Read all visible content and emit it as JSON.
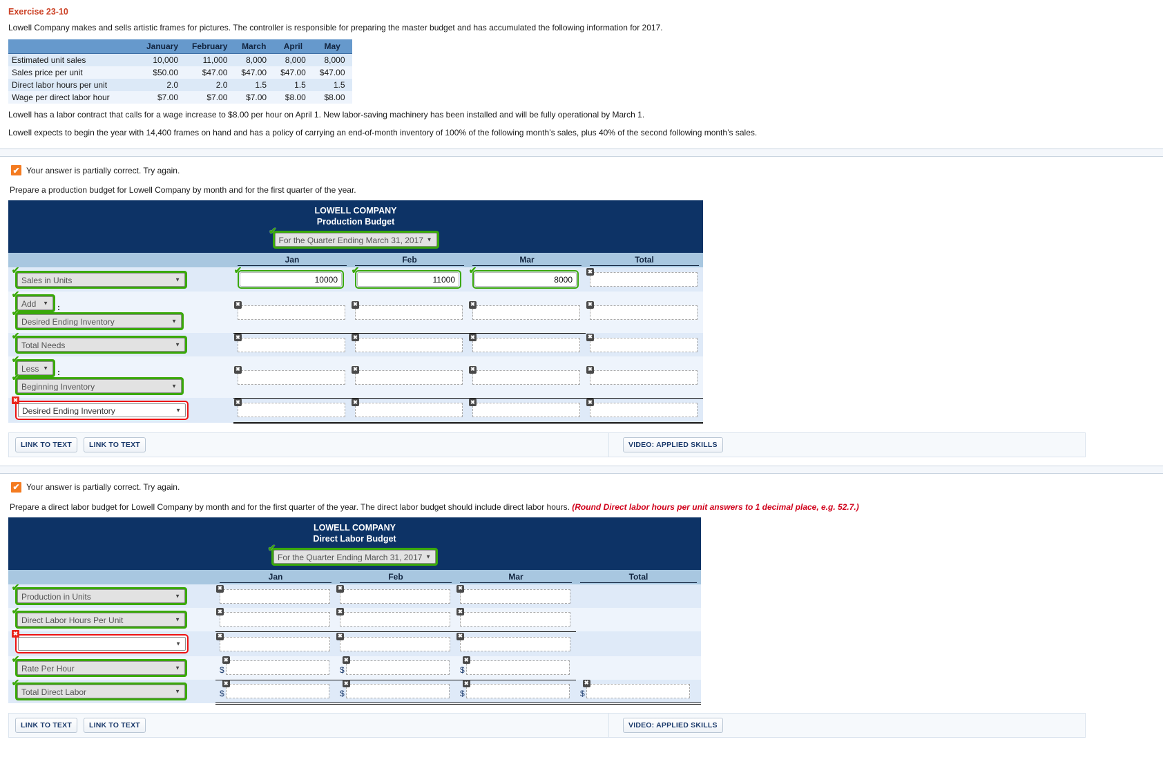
{
  "exercise": {
    "title": "Exercise 23-10",
    "intro": "Lowell Company makes and sells artistic frames for pictures. The controller is responsible for preparing the master budget and has accumulated the following information for 2017.",
    "note1": "Lowell has a labor contract that calls for a wage increase to $8.00 per hour on April 1. New labor-saving machinery has been installed and will be fully operational by March 1.",
    "note2": "Lowell expects to begin the year with 14,400 frames on hand and has a policy of carrying an end-of-month inventory of 100% of the following month’s sales, plus 40% of the second following month’s sales."
  },
  "facts_table": {
    "corner": "",
    "columns": [
      "January",
      "February",
      "March",
      "April",
      "May"
    ],
    "rows": [
      {
        "label": "Estimated unit sales",
        "values": [
          "10,000",
          "11,000",
          "8,000",
          "8,000",
          "8,000"
        ]
      },
      {
        "label": "Sales price per unit",
        "values": [
          "$50.00",
          "$47.00",
          "$47.00",
          "$47.00",
          "$47.00"
        ]
      },
      {
        "label": "Direct labor hours per unit",
        "values": [
          "2.0",
          "2.0",
          "1.5",
          "1.5",
          "1.5"
        ]
      },
      {
        "label": "Wage per direct labor hour",
        "values": [
          "$7.00",
          "$7.00",
          "$7.00",
          "$8.00",
          "$8.00"
        ]
      }
    ]
  },
  "part1": {
    "feedback": {
      "icon": "partial-correct-icon",
      "text": "Your answer is partially correct.  Try again."
    },
    "prompt": "Prepare a production budget for Lowell Company by month and for the first quarter of the year.",
    "budget": {
      "company": "LOWELL COMPANY",
      "title": "Production Budget",
      "period_select": "For the Quarter Ending March 31, 2017",
      "columns": [
        "Jan",
        "Feb",
        "Mar",
        "Total"
      ],
      "rows": [
        {
          "prefix": null,
          "label": "Sales in Units",
          "label_state": "ok",
          "cells": [
            {
              "value": "10000",
              "state": "ok",
              "dollar": false,
              "rule": "none"
            },
            {
              "value": "11000",
              "state": "ok",
              "dollar": false,
              "rule": "none"
            },
            {
              "value": "8000",
              "state": "ok",
              "dollar": false,
              "rule": "none"
            },
            {
              "value": "",
              "state": "bad",
              "dollar": false,
              "rule": "none"
            }
          ]
        },
        {
          "prefix": "Add",
          "prefix_state": "ok",
          "label": "Desired Ending Inventory",
          "label_state": "ok",
          "cells": [
            {
              "value": "",
              "state": "bad",
              "dollar": false,
              "rule": "single"
            },
            {
              "value": "",
              "state": "bad",
              "dollar": false,
              "rule": "single"
            },
            {
              "value": "",
              "state": "bad",
              "dollar": false,
              "rule": "single"
            },
            {
              "value": "",
              "state": "bad",
              "dollar": false,
              "rule": "single"
            }
          ]
        },
        {
          "prefix": null,
          "label": "Total Needs",
          "label_state": "ok",
          "cells": [
            {
              "value": "",
              "state": "bad",
              "dollar": false,
              "rule": "none"
            },
            {
              "value": "",
              "state": "bad",
              "dollar": false,
              "rule": "none"
            },
            {
              "value": "",
              "state": "bad",
              "dollar": false,
              "rule": "none"
            },
            {
              "value": "",
              "state": "bad",
              "dollar": false,
              "rule": "none"
            }
          ]
        },
        {
          "prefix": "Less",
          "prefix_state": "ok",
          "label": "Beginning Inventory",
          "label_state": "ok",
          "cells": [
            {
              "value": "",
              "state": "bad",
              "dollar": false,
              "rule": "single"
            },
            {
              "value": "",
              "state": "bad",
              "dollar": false,
              "rule": "single"
            },
            {
              "value": "",
              "state": "bad",
              "dollar": false,
              "rule": "single"
            },
            {
              "value": "",
              "state": "bad",
              "dollar": false,
              "rule": "single"
            }
          ]
        },
        {
          "prefix": null,
          "label": "Desired Ending Inventory",
          "label_state": "error",
          "cells": [
            {
              "value": "",
              "state": "bad",
              "dollar": false,
              "rule": "double"
            },
            {
              "value": "",
              "state": "bad",
              "dollar": false,
              "rule": "double"
            },
            {
              "value": "",
              "state": "bad",
              "dollar": false,
              "rule": "double"
            },
            {
              "value": "",
              "state": "bad",
              "dollar": false,
              "rule": "double"
            }
          ]
        }
      ]
    },
    "buttons": {
      "link1": "LINK TO TEXT",
      "link2": "LINK TO TEXT",
      "video": "VIDEO: APPLIED SKILLS"
    }
  },
  "part2": {
    "feedback": {
      "icon": "partial-correct-icon",
      "text": "Your answer is partially correct.  Try again."
    },
    "prompt": "Prepare a direct labor budget for Lowell Company by month and for the first quarter of the year. The direct labor budget should include direct labor hours.",
    "prompt_hint": "(Round Direct labor hours per unit answers to 1 decimal place, e.g. 52.7.)",
    "budget": {
      "company": "LOWELL COMPANY",
      "title": "Direct Labor Budget",
      "period_select": "For the Quarter Ending March 31, 2017",
      "columns": [
        "Jan",
        "Feb",
        "Mar",
        "Total"
      ],
      "rows": [
        {
          "label": "Production in Units",
          "label_state": "ok",
          "cells": [
            {
              "value": "",
              "state": "bad",
              "dollar": false,
              "rule": "none"
            },
            {
              "value": "",
              "state": "bad",
              "dollar": false,
              "rule": "none"
            },
            {
              "value": "",
              "state": "bad",
              "dollar": false,
              "rule": "none"
            },
            {
              "value": null
            }
          ]
        },
        {
          "label": "Direct Labor Hours Per Unit",
          "label_state": "ok",
          "cells": [
            {
              "value": "",
              "state": "bad",
              "dollar": false,
              "rule": "single"
            },
            {
              "value": "",
              "state": "bad",
              "dollar": false,
              "rule": "single"
            },
            {
              "value": "",
              "state": "bad",
              "dollar": false,
              "rule": "single"
            },
            {
              "value": null
            }
          ]
        },
        {
          "label": "",
          "label_state": "error",
          "cells": [
            {
              "value": "",
              "state": "bad",
              "dollar": false,
              "rule": "none"
            },
            {
              "value": "",
              "state": "bad",
              "dollar": false,
              "rule": "none"
            },
            {
              "value": "",
              "state": "bad",
              "dollar": false,
              "rule": "none"
            },
            {
              "value": null
            }
          ]
        },
        {
          "label": "Rate Per Hour",
          "label_state": "ok",
          "cells": [
            {
              "value": "",
              "state": "bad",
              "dollar": true,
              "rule": "single"
            },
            {
              "value": "",
              "state": "bad",
              "dollar": true,
              "rule": "single"
            },
            {
              "value": "",
              "state": "bad",
              "dollar": true,
              "rule": "single"
            },
            {
              "value": null
            }
          ]
        },
        {
          "label": "Total Direct Labor",
          "label_state": "ok",
          "cells": [
            {
              "value": "",
              "state": "bad",
              "dollar": true,
              "rule": "double"
            },
            {
              "value": "",
              "state": "bad",
              "dollar": true,
              "rule": "double"
            },
            {
              "value": "",
              "state": "bad",
              "dollar": true,
              "rule": "double"
            },
            {
              "value": "",
              "state": "bad",
              "dollar": true,
              "rule": "double"
            }
          ]
        }
      ]
    },
    "buttons": {
      "link1": "LINK TO TEXT",
      "link2": "LINK TO TEXT",
      "video": "VIDEO: APPLIED SKILLS"
    }
  },
  "icons": {
    "check": "✔",
    "cross": "✖",
    "caret_down": "▼"
  },
  "colors": {
    "header_navy": "#0d3366",
    "col_header_blue": "#a8c7e0",
    "facts_header_blue": "#6699cc",
    "ok_green": "#3aa80a",
    "error_red": "#ee1111",
    "accent_orange": "#f47b20",
    "hint_red": "#d0021b",
    "exercise_title": "#cc4125"
  }
}
